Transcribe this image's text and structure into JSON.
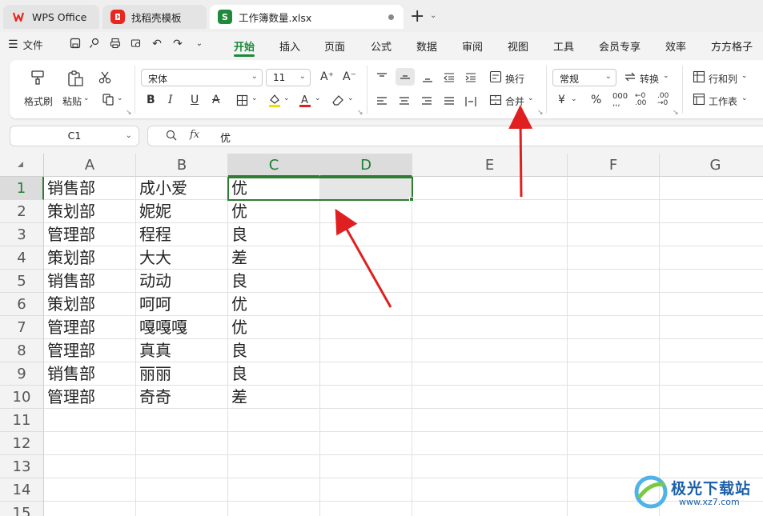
{
  "tabs": [
    {
      "label": "WPS Office",
      "logo_color": "#e8281e"
    },
    {
      "label": "找稻壳模板",
      "logo_color": "#e8281e"
    },
    {
      "label": "工作簿数量.xlsx",
      "logo_color": "#1f8a3c",
      "logo_letter": "S"
    }
  ],
  "menu": {
    "file_label": "文件",
    "tabs": [
      "开始",
      "插入",
      "页面",
      "公式",
      "数据",
      "审阅",
      "视图",
      "工具",
      "会员专享",
      "效率",
      "方方格子"
    ],
    "active_tab": "开始"
  },
  "ribbon": {
    "format_painter": "格式刷",
    "paste": "粘贴",
    "font_name": "宋体",
    "font_size": "11",
    "wrap": "换行",
    "merge": "合并",
    "number_format": "常规",
    "convert": "转换",
    "rows_cols": "行和列",
    "worksheet": "工作表",
    "bold": "B",
    "italic": "I",
    "underline": "U",
    "percent": "%"
  },
  "formula_bar": {
    "cell_ref": "C1",
    "fx": "fx",
    "value": "优"
  },
  "sheet": {
    "columns": [
      "A",
      "B",
      "C",
      "D",
      "E",
      "F",
      "G"
    ],
    "rows": [
      [
        "销售部",
        "成小爱",
        "优"
      ],
      [
        "策划部",
        "妮妮",
        "优"
      ],
      [
        "管理部",
        "程程",
        "良"
      ],
      [
        "策划部",
        "大大",
        "差"
      ],
      [
        "销售部",
        "动动",
        "良"
      ],
      [
        "策划部",
        "呵呵",
        "优"
      ],
      [
        "管理部",
        "嘎嘎嘎",
        "优"
      ],
      [
        "管理部",
        "真真",
        "良"
      ],
      [
        "销售部",
        "丽丽",
        "良"
      ],
      [
        "管理部",
        "奇奇",
        "差"
      ],
      [
        "",
        "",
        ""
      ],
      [
        "",
        "",
        ""
      ],
      [
        "",
        "",
        ""
      ],
      [
        "",
        "",
        ""
      ],
      [
        "",
        "",
        ""
      ]
    ],
    "row_numbers": [
      "1",
      "2",
      "3",
      "4",
      "5",
      "6",
      "7",
      "8",
      "9",
      "10",
      "11",
      "12",
      "13",
      "14",
      "15"
    ],
    "selected_range": "C1:D1"
  },
  "watermark": {
    "text": "极光下载站",
    "url": "www.xz7.com"
  },
  "colors": {
    "accent": "#1a8a3a",
    "selection": "#2e7d32",
    "annotation_arrow": "#e02020"
  }
}
